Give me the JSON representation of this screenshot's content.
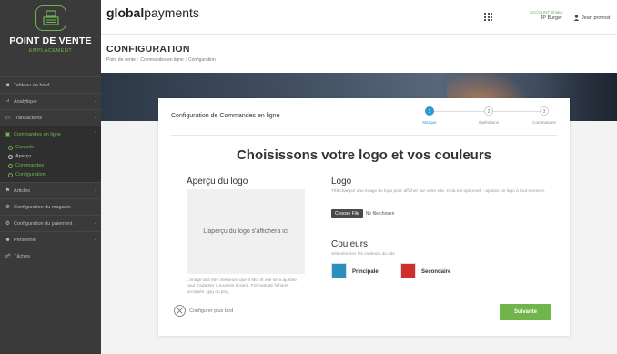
{
  "sidebar": {
    "brand_title": "POINT DE VENTE",
    "brand_subtitle": "EMPLACEMENT",
    "items": [
      {
        "label": "Tableau de bord",
        "icon": "dashboard-icon"
      },
      {
        "label": "Analytique",
        "icon": "chart-icon"
      },
      {
        "label": "Transactions",
        "icon": "card-icon"
      },
      {
        "label": "Commandes en ligne",
        "icon": "bag-icon"
      },
      {
        "label": "Articles",
        "icon": "tag-icon"
      },
      {
        "label": "Configuration du magasin",
        "icon": "gear-icon"
      },
      {
        "label": "Configuration du paiement",
        "icon": "gear-icon"
      },
      {
        "label": "Personnel",
        "icon": "people-icon"
      },
      {
        "label": "Tâches",
        "icon": "tasks-icon"
      }
    ],
    "subitems": [
      {
        "label": "Console"
      },
      {
        "label": "Aperçu"
      },
      {
        "label": "Commandes"
      },
      {
        "label": "Configuration"
      }
    ]
  },
  "topbar": {
    "logo_bold": "global",
    "logo_light": "payments",
    "account_label": "ACCOUNT Shaka",
    "account_name": "JP Burger",
    "user_name": "Jean provost"
  },
  "page": {
    "title": "CONFIGURATION",
    "breadcrumb": [
      "Point de vente",
      "Commandes en ligne",
      "Configuration"
    ]
  },
  "card": {
    "title": "Configuration de Commandes en ligne",
    "steps": [
      {
        "number": "1",
        "label": "Marque"
      },
      {
        "number": "2",
        "label": "Opérations"
      },
      {
        "number": "3",
        "label": "Commandes"
      }
    ],
    "heading": "Choisissons votre logo et vos couleurs",
    "preview_title": "Aperçu du logo",
    "preview_placeholder": "L'aperçu du logo s'affichera ici",
    "preview_note": "L'image doit être inférieure que 5 Mo, et elle sera ajustée pour s'adapter à tous les écrans. Formats de fichiers acceptés - jpg ou png.",
    "logo_title": "Logo",
    "logo_desc": "Téléchargez une image de logo pour afficher sur votre site. Cela est optionnel - ajoutez un logo à tout moment.",
    "file_button": "Choose File",
    "file_status": "No file chosen",
    "colors_title": "Couleurs",
    "colors_desc": "Sélectionnez les couleurs du site",
    "primary_label": "Principale",
    "secondary_label": "Secondaire",
    "later_label": "Configurer plus tard",
    "next_label": "Suivante"
  },
  "colors": {
    "accent_green": "#6fb54c",
    "step_blue": "#2b9bd0",
    "primary_swatch": "#2b8fc0",
    "secondary_swatch": "#cf2e2e"
  }
}
